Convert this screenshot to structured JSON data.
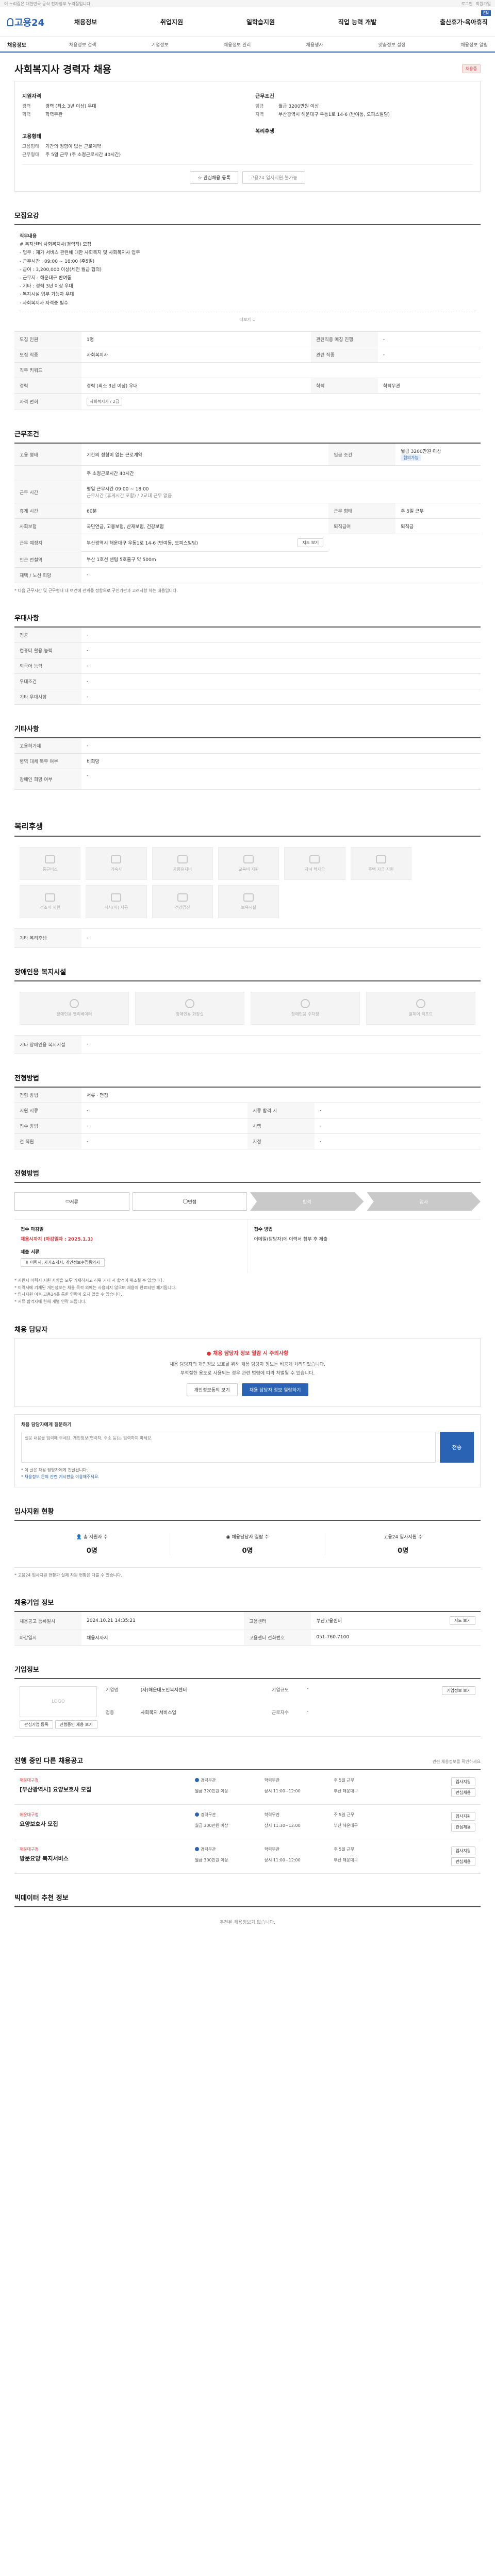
{
  "topbar": {
    "left": "이 누리집은 대한민국 공식 전자정부 누리집입니다.",
    "right": [
      "로그인",
      "회원가입"
    ]
  },
  "header": {
    "logo": "고용24",
    "gnb": [
      "채용정보",
      "취업지원",
      "일학습지원",
      "직업 능력 개발",
      "출산휴가·육아휴직"
    ],
    "lang": "EN"
  },
  "subnav": {
    "crumb": "채용정보",
    "tabs": [
      "채용정보 검색",
      "기업정보",
      "채용정보 관리",
      "채용행사",
      "맞춤정보 설정",
      "채용정보 알림"
    ]
  },
  "job": {
    "title": "사회복지사 경력자 채용",
    "badge": "채용중",
    "summary": {
      "left_title": "지원자격",
      "left_rows": [
        {
          "k": "경력",
          "v": "경력 (최소 3년 이상) 우대"
        },
        {
          "k": "학력",
          "v": "학력무관"
        }
      ],
      "right_title": "근무조건",
      "right_rows": [
        {
          "k": "임금",
          "v": "월급 3200만원 이상"
        },
        {
          "k": "지역",
          "v": "부산광역시 해운대구 우동1로 14-6 (반여동, 오피스빌딩)"
        }
      ],
      "left_title2": "고용형태",
      "left_rows2": [
        {
          "k": "고용형태",
          "v": "기간의 정함이 없는 근로계약"
        },
        {
          "k": "근무형태",
          "v": "주 5일 근무 (주 소정근로시간 40시간)"
        }
      ],
      "right_title2": "복리후생",
      "btn_save": "관심채용 등록",
      "btn_apply": "고용24 입사지원 불가능"
    }
  },
  "recruit": {
    "title": "모집요강",
    "desc_lines": [
      "직무내용",
      "# 복지센터 사회복지사(경력직) 모집",
      "",
      "- 업무 : 재가 서비스 관련해 대한 사회복지 및 사회복지사 업무",
      "- 근무시간 : 09:00 ~ 18:00 (주5일)",
      "- 급여 : 3,200,000 이상(세전 월급 협의)",
      "- 근무지 : 해운대구 반여동",
      "- 기타 : 경력 3년 이상 우대",
      "  · 복지시설 업무 가능자 우대",
      "  · 사회복지사 자격증 필수"
    ],
    "more": "더보기",
    "rows": [
      {
        "k": "모집 직종",
        "v": "사회복지사",
        "k2": "관련직종",
        "v2": "-"
      },
      {
        "k": "모집 인원",
        "v": "1명",
        "k2": "영어 매체 의무",
        "v2": "-"
      },
      {
        "k": "직무 키워드",
        "v": "",
        "k2": "",
        "v2": ""
      },
      {
        "k": "경력",
        "v": "경력 (최소 3년 이상) 우대",
        "k2": "학력",
        "v2": "학력무관"
      },
      {
        "k": "자격 면허",
        "v": "사회복지사 2급"
      }
    ],
    "row_labels": [
      "모집 인원",
      "모집 직종",
      "직무 키워드",
      "경력",
      "자격 면허"
    ],
    "row_values": [
      "1명",
      "사회복지사",
      "",
      "경력 (최소 3년 이상) 우대",
      "사회복지사 / 2급"
    ],
    "row_labels2": [
      "관련직종 매칭 진행",
      "관련 직종",
      "",
      "학력",
      ""
    ],
    "row_values2": [
      "-",
      "-",
      "",
      "학력무관",
      ""
    ]
  },
  "conditions": {
    "title": "근무조건",
    "rows": [
      {
        "k": "고용 형태",
        "v": "기간의 정함이 없는 근로계약",
        "k2": "임금 조건",
        "v2": "월급 3200만원 이상",
        "tag": "협의가능"
      },
      {
        "k": "",
        "v": "주 소정근로시간 40시간"
      },
      {
        "k": "근무 시간",
        "v": "평일 근무시간 09:00 ~ 18:00",
        "v_sub": "근무시간 (휴게시간 포함) / 2교대 근무 없음"
      },
      {
        "k": "휴게 시간",
        "v": "60분",
        "k2": "근무 형태",
        "v2": "주 5일 근무"
      },
      {
        "k": "사회보험",
        "v": "국민연금, 고용보험, 산재보험, 건강보험",
        "k2": "퇴직급여",
        "v2": "퇴직금"
      },
      {
        "k": "근무 예정지",
        "v": "부산광역시 해운대구 우동1로 14-6 (반여동, 오피스빌딩)",
        "btn": "지도 보기"
      },
      {
        "k": "인근 전철역",
        "v": "부산 1호선 센텀 5호출구 약 500m"
      },
      {
        "k": "재택 / 노선 희망",
        "v": "-"
      }
    ],
    "note": "* 다음 근무시간 및 근무형태 내 여건에 관계를 정함으로 구인기관과 고려사항 하는 내용입니다."
  },
  "preference": {
    "title": "우대사항",
    "rows": [
      {
        "k": "전공",
        "v": "-"
      },
      {
        "k": "컴퓨터 활용 능력",
        "v": "-"
      },
      {
        "k": "외국어 능력",
        "v": "-"
      },
      {
        "k": "우대조건",
        "v": "-"
      },
      {
        "k": "기타 우대사항",
        "v": "-"
      }
    ]
  },
  "other": {
    "title": "기타사항",
    "rows": [
      {
        "k": "고용허가제",
        "v": "-"
      },
      {
        "k": "병역 대체 복무 여부",
        "v": "비희망"
      },
      {
        "k": "장애인 희망 여부",
        "v": "-"
      }
    ]
  },
  "welfare": {
    "title": "복리후생",
    "items": [
      "통근버스",
      "기숙사",
      "차량유지비",
      "교육비 지원",
      "자녀 학자금",
      "주택 자금 지원",
      "경조비 지원",
      "식사(비) 제공",
      "건강검진",
      "보육시설"
    ],
    "extra_label": "기타 복리후생",
    "extra_value": "-"
  },
  "disability": {
    "title": "장애인용 복지시설",
    "items": [
      "장애인용 엘리베이터",
      "장애인용 화장실",
      "장애인용 주차장",
      "휠체어 리프트"
    ],
    "extra_label": "기타 장애인용 복지시설",
    "extra_value": "-"
  },
  "screening": {
    "title": "전형방법",
    "rows": [
      {
        "k": "전형 방법",
        "v": "서류 · 면접",
        "k2": "",
        "": ""
      },
      {
        "k": "지원 서류",
        "v": "-",
        "k2": "서류 합격 시",
        "v2": "-"
      },
      {
        "k": "접수 방법",
        "v": "-",
        "k2": "시행",
        "v2": "-"
      },
      {
        "k": "전 직원",
        "v": "-",
        "k2": "지정",
        "v2": "-"
      }
    ],
    "steps": [
      "서류",
      "면접",
      "합격",
      "입사"
    ]
  },
  "apply": {
    "title": "전형방법",
    "deadline_label": "접수 마감일",
    "deadline": "채용시까지 (마감일자 : 2025.1.1)",
    "method_label": "접수 방법",
    "method": "이메일(담당자)에 이력서 첨부 후 제출",
    "docs_label": "제출 서류",
    "docs": "이력서, 자기소개서, 개인정보수집동의서",
    "notes": [
      "* 지원시 이력서 지원 사항을 모두 기재하시고 허위 기재 시 합격이 취소될 수 있습니다.",
      "* 이력서에 기재된 개인정보는 채용 목적 외에는 사용되지 않으며 채용이 완료되면 폐기됩니다.",
      "* 입사지원 이후 고용24를 통한 연락이 오지 않을 수 있습니다.",
      "* 서류 합격자에 한해 개별 연락 드립니다."
    ]
  },
  "contact": {
    "title": "채용 담당자",
    "alert": "채용 담당자 정보 열람 시 주의사항",
    "text1": "채용 담당자의 개인정보 보호를 위해 채용 담당자 정보는 비공개 처리되었습니다.",
    "text2": "부적절한 용도로 사용되는 경우 관련 법령에 따라 처벌될 수 있습니다.",
    "btn_agree": "개인정보동의 보기",
    "btn_view": "채용 담당자 정보 열람하기",
    "inquiry_title": "채용 담당자에게 질문하기",
    "inquiry_placeholder": "질문 내용을 입력해 주세요. 개인정보(연락처, 주소 등)는 입력하지 마세요.",
    "inquiry_btn": "전송",
    "inquiry_note1": "* 이 글은 채용 담당자에게 전달됩니다.",
    "inquiry_note2": "* 채용정보 문의 관련 게시판을 이용해주세요."
  },
  "stats": {
    "title": "입사지원 현황",
    "items": [
      {
        "label": "총 지원자 수",
        "value": "0명"
      },
      {
        "label": "채용담당자 열람 수",
        "value": "0명"
      },
      {
        "label": "고용24 입사지원 수",
        "value": "0명"
      }
    ],
    "note": "* 고용24 입사지원 현황과 실제 지원 현황은 다를 수 있습니다."
  },
  "register": {
    "title": "채용기업 정보",
    "rows": [
      {
        "k": "채용공고 등록일시",
        "v": "2024.10.21 14:35:21",
        "k2": "고용센터",
        "v2": "부산고용센터"
      },
      {
        "k": "마감일시",
        "v": "채용시까지",
        "k2": "고용센터 전화번호",
        "v2": "051-760-7100"
      }
    ],
    "btn": "지도 보기"
  },
  "company": {
    "title": "기업정보",
    "logo_placeholder": "LOGO",
    "name_label": "기업명",
    "name": "(사)해운대노인복지센터",
    "industry_label": "업종",
    "industry": "사회복지 서비스업",
    "size_label": "기업규모",
    "size": "-",
    "employees_label": "근로자수",
    "employees": "-",
    "btn_info": "기업정보 보기",
    "btn_jobs": "진행중인 채용 보기",
    "btn_follow": "관심기업 등록"
  },
  "recommend": {
    "title": "진행 중인 다른 채용공고",
    "note": "관련 채용정보를 확인하세요",
    "items": [
      {
        "company": "해운대구청",
        "title": "[부산광역시] 요양보호사 모집",
        "meta": [
          "경력무관",
          "학력무관",
          "주 5일 근무",
          "월급 320만원 이상",
          "상시 11:00~12:00",
          "부산 해운대구"
        ],
        "btn1": "입사지원",
        "btn2": "관심채용"
      },
      {
        "company": "해운대구청",
        "title": "요양보호사 모집",
        "meta": [
          "경력무관",
          "학력무관",
          "주 5일 근무",
          "월급 300만원 이상",
          "상시 11:30~12:00",
          "부산 해운대구"
        ],
        "btn1": "입사지원",
        "btn2": "관심채용"
      },
      {
        "company": "해운대구청",
        "title": "방문요양 복지서비스",
        "meta": [
          "경력무관",
          "학력무관",
          "주 5일 근무",
          "월급 300만원 이상",
          "상시 11:00~12:00",
          "부산 해운대구"
        ],
        "btn1": "입사지원",
        "btn2": "관심채용"
      }
    ]
  },
  "footer": {
    "title": "빅데이터 추천 정보",
    "text": "추천된 채용정보가 없습니다."
  }
}
